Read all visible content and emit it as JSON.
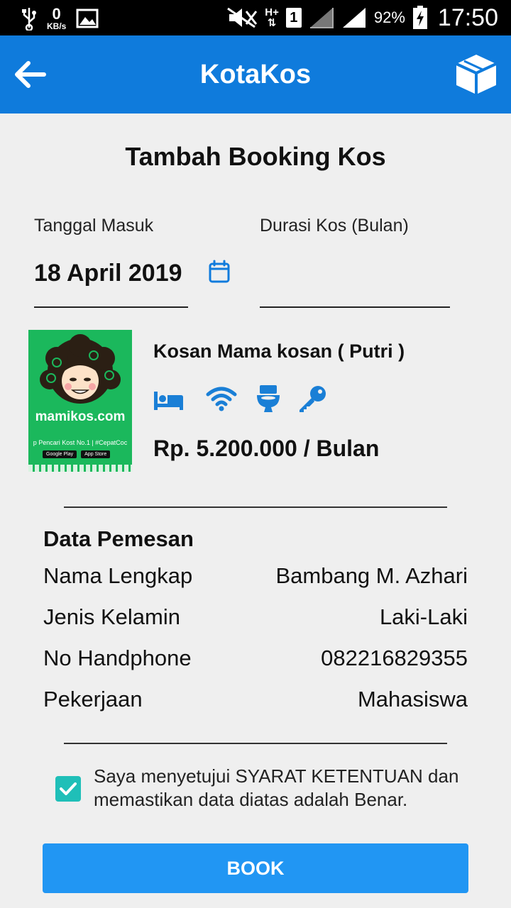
{
  "status_bar": {
    "net_speed": "0",
    "net_unit": "KB/s",
    "network_type": "H+",
    "sim_slot": "1",
    "battery": "92%",
    "time": "17:50",
    "icons": [
      "usb-icon",
      "image-icon",
      "mute-icon",
      "signal-icon",
      "battery-charging-icon"
    ]
  },
  "app_bar": {
    "title": "KotaKos",
    "back_icon": "arrow-left-icon",
    "action_icon": "box-icon",
    "color": "#0f7bdc"
  },
  "page": {
    "title": "Tambah Booking Kos"
  },
  "form": {
    "date_label": "Tanggal Masuk",
    "date_value": "18 April 2019",
    "duration_label": "Durasi Kos (Bulan)",
    "duration_value": ""
  },
  "kos": {
    "logo_text": "mamikos.com",
    "logo_strip": "p Pencari Kost No.1 | #CepatCoc",
    "logo_buttons": [
      "Google Play",
      "App Store"
    ],
    "name": "Kosan Mama kosan ( Putri )",
    "facilities": [
      "bed-icon",
      "wifi-icon",
      "toilet-icon",
      "key-icon"
    ],
    "price": "Rp. 5.200.000 / Bulan"
  },
  "pemesan": {
    "title": "Data Pemesan",
    "rows": [
      {
        "label": "Nama Lengkap",
        "value": "Bambang M. Azhari"
      },
      {
        "label": "Jenis Kelamin",
        "value": "Laki-Laki"
      },
      {
        "label": "No Handphone",
        "value": "082216829355"
      },
      {
        "label": "Pekerjaan",
        "value": "Mahasiswa"
      }
    ]
  },
  "agreement": {
    "checked": true,
    "text": "Saya menyetujui SYARAT KETENTUAN dan memastikan data diatas adalah Benar."
  },
  "book_button": {
    "label": "BOOK",
    "color": "#2196f3"
  },
  "accent": "#0f7bdc"
}
